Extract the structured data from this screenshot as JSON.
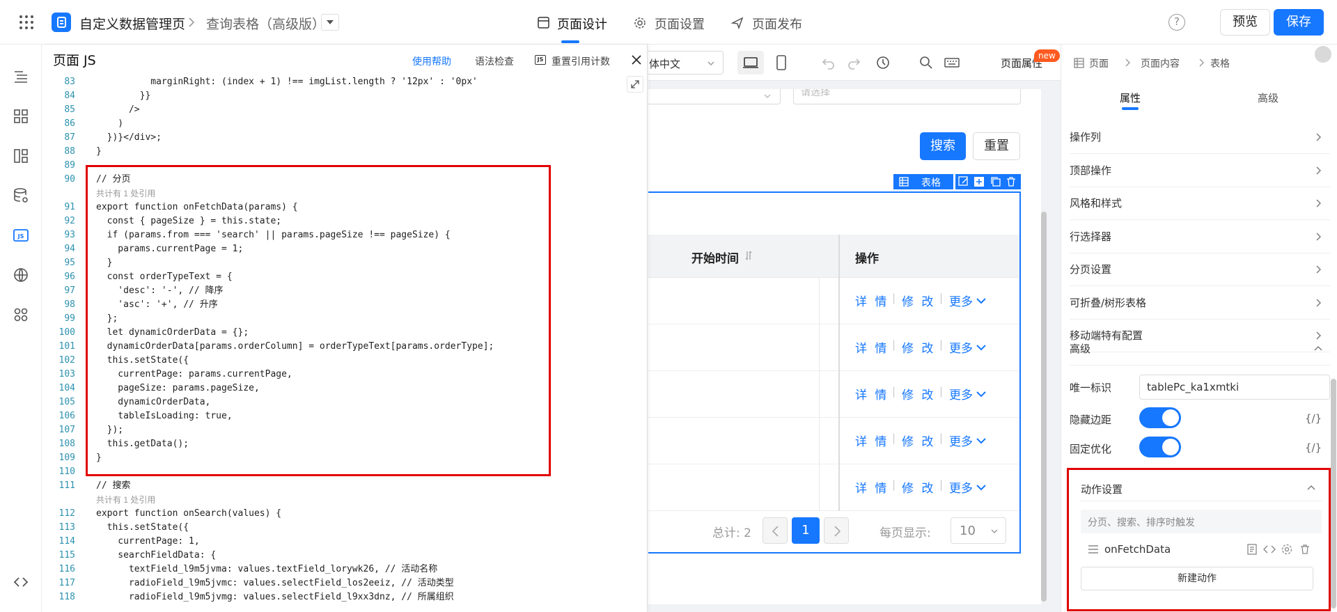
{
  "topbar": {
    "app_title": "自定义数据管理页",
    "breadcrumb_current": "查询表格（高级版）",
    "tabs": [
      {
        "label": "页面设计"
      },
      {
        "label": "页面设置"
      },
      {
        "label": "页面发布"
      }
    ],
    "preview_label": "预览",
    "save_label": "保存"
  },
  "editor": {
    "title": "页面 JS",
    "help_label": "使用帮助",
    "lint_label": "语法检查",
    "reset_label": "重置引用计数",
    "lines": [
      {
        "n": "83",
        "t": "          marginRight: (index + 1) !== imgList.length ? '12px' : '0px'"
      },
      {
        "n": "84",
        "t": "        }}"
      },
      {
        "n": "85",
        "t": "      />"
      },
      {
        "n": "86",
        "t": "    )"
      },
      {
        "n": "87",
        "t": "  })}</div>;"
      },
      {
        "n": "88",
        "t": "}"
      },
      {
        "n": "89",
        "t": ""
      },
      {
        "n": "90",
        "t": "// 分页"
      },
      {
        "n": "91",
        "t": "export function onFetchData(params) {"
      },
      {
        "n": "92",
        "t": "  const { pageSize } = this.state;"
      },
      {
        "n": "93",
        "t": "  if (params.from === 'search' || params.pageSize !== pageSize) {"
      },
      {
        "n": "94",
        "t": "    params.currentPage = 1;"
      },
      {
        "n": "95",
        "t": "  }"
      },
      {
        "n": "96",
        "t": "  const orderTypeText = {"
      },
      {
        "n": "97",
        "t": "    'desc': '-', // 降序"
      },
      {
        "n": "98",
        "t": "    'asc': '+', // 升序"
      },
      {
        "n": "99",
        "t": "  };"
      },
      {
        "n": "100",
        "t": "  let dynamicOrderData = {};"
      },
      {
        "n": "101",
        "t": "  dynamicOrderData[params.orderColumn] = orderTypeText[params.orderType];"
      },
      {
        "n": "102",
        "t": "  this.setState({"
      },
      {
        "n": "103",
        "t": "    currentPage: params.currentPage,"
      },
      {
        "n": "104",
        "t": "    pageSize: params.pageSize,"
      },
      {
        "n": "105",
        "t": "    dynamicOrderData,"
      },
      {
        "n": "106",
        "t": "    tableIsLoading: true,"
      },
      {
        "n": "107",
        "t": "  });"
      },
      {
        "n": "108",
        "t": "  this.getData();"
      },
      {
        "n": "109",
        "t": "}"
      },
      {
        "n": "110",
        "t": ""
      },
      {
        "n": "111",
        "t": "// 搜索"
      },
      {
        "n": "112",
        "t": "export function onSearch(values) {"
      },
      {
        "n": "113",
        "t": "  this.setState({"
      },
      {
        "n": "114",
        "t": "    currentPage: 1,"
      },
      {
        "n": "115",
        "t": "    searchFieldData: {"
      },
      {
        "n": "116",
        "t": "      textField_l9m5jvma: values.textField_lorywk26, // 活动名称"
      },
      {
        "n": "117",
        "t": "      radioField_l9m5jvmc: values.selectField_los2eeiz, // 活动类型"
      },
      {
        "n": "118",
        "t": "      radioField_l9m5jvmg: values.selectField_l9xx3dnz, // 所属组织"
      }
    ],
    "ref_count_1": "共计有 1 处引用",
    "ref_count_2": "共计有 1 处引用"
  },
  "canvas": {
    "lang_label": "简体中文",
    "page_attr_label": "页面属性",
    "new_badge": "new",
    "select_placeholder": "请选择",
    "search_btn": "搜索",
    "reset_btn": "重置",
    "component_tag": "表格",
    "col_start_time": "开始时间",
    "col_action": "操作",
    "row_actions": {
      "detail": "详 情",
      "edit": "修 改",
      "more": "更多"
    },
    "rows": 5,
    "total_label": "总计: 2",
    "current_page": "1",
    "page_size_label": "每页显示:",
    "page_size": "10"
  },
  "panel": {
    "breadcrumb": [
      "页面",
      "页面内容",
      "表格"
    ],
    "tab_props": "属性",
    "tab_advanced": "高级",
    "sections": [
      "操作列",
      "顶部操作",
      "风格和样式",
      "行选择器",
      "分页设置",
      "可折叠/树形表格",
      "移动端特有配置"
    ],
    "advanced_label": "高级",
    "uid_label": "唯一标识",
    "uid_value": "tablePc_ka1xmtki",
    "hide_margin_label": "隐藏边距",
    "fixed_opt_label": "固定优化",
    "expr_label": "{/}",
    "action_section": "动作设置",
    "action_trigger_desc": "分页、搜索、排序时触发",
    "action_name": "onFetchData",
    "new_action_label": "新建动作"
  },
  "colors": {
    "primary": "#1677ff",
    "highlight": "#e00000"
  }
}
